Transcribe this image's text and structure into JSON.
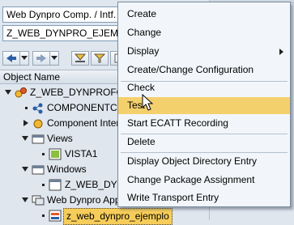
{
  "combos": {
    "object_type": "Web Dynpro Comp. / Intf.",
    "object_name": "Z_WEB_DYNPRO_EJEMPLO"
  },
  "toolbar": {
    "icons": [
      "arrow-left-icon",
      "dropdown-icon",
      "arrow-right-icon",
      "dropdown-icon",
      "display-icon",
      "filter-icon",
      "tree-icon"
    ]
  },
  "header": {
    "object_name": "Object Name"
  },
  "tree": {
    "root": "Z_WEB_DYNPROFOR",
    "componentcontroller": "COMPONENTCONTROLLER",
    "component_interface": "Component Interface",
    "views": "Views",
    "vista1": "VISTA1",
    "windows": "Windows",
    "window_item": "Z_WEB_DYNPRO",
    "web_dynpro_app": "Web Dynpro Applications",
    "app_item": "z_web_dynpro_ejemplo"
  },
  "context_menu": {
    "items": [
      "Create",
      "Change",
      "Display",
      "Create/Change Configuration",
      "Check",
      "Test",
      "Start ECATT Recording",
      "Delete",
      "Display Object Directory Entry",
      "Change Package Assignment",
      "Write Transport Entry"
    ],
    "highlighted": "Test",
    "highlight_color": "#f4d06d"
  },
  "colors": {
    "panel_bg": "#dfe6ee",
    "selection": "#f6cd5a",
    "menu_bg": "#f2f6fa"
  }
}
